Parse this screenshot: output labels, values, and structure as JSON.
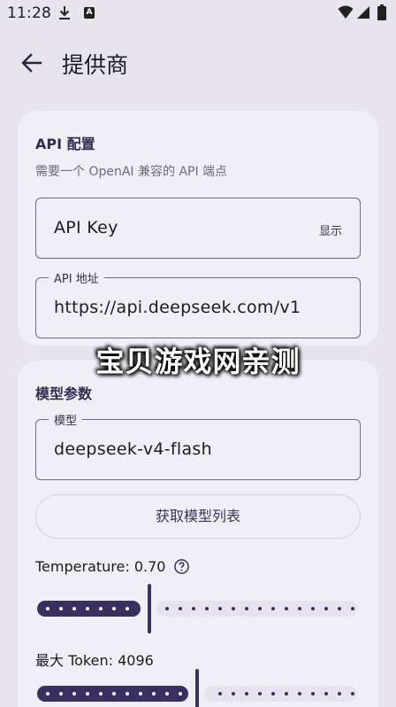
{
  "status_bar": {
    "time": "11:28"
  },
  "appbar": {
    "title": "提供商"
  },
  "api_card": {
    "title": "API 配置",
    "subtitle": "需要一个 OpenAI 兼容的 API 端点",
    "api_key": {
      "placeholder": "API Key",
      "toggle_label": "显示"
    },
    "api_url": {
      "label": "API 地址",
      "value": "https://api.deepseek.com/v1"
    }
  },
  "model_card": {
    "title": "模型参数",
    "model": {
      "label": "模型",
      "value": "deepseek-v4-flash"
    },
    "fetch_button": "获取模型列表",
    "temperature": {
      "label": "Temperature: 0.70",
      "fraction": 0.35
    },
    "max_tokens": {
      "label": "最大 Token: 4096",
      "fraction": 0.5
    }
  },
  "watermark": "宝贝游戏网亲测",
  "colors": {
    "background": "#e7e4ee",
    "card": "#f0eef6",
    "accent": "#3a3060"
  }
}
